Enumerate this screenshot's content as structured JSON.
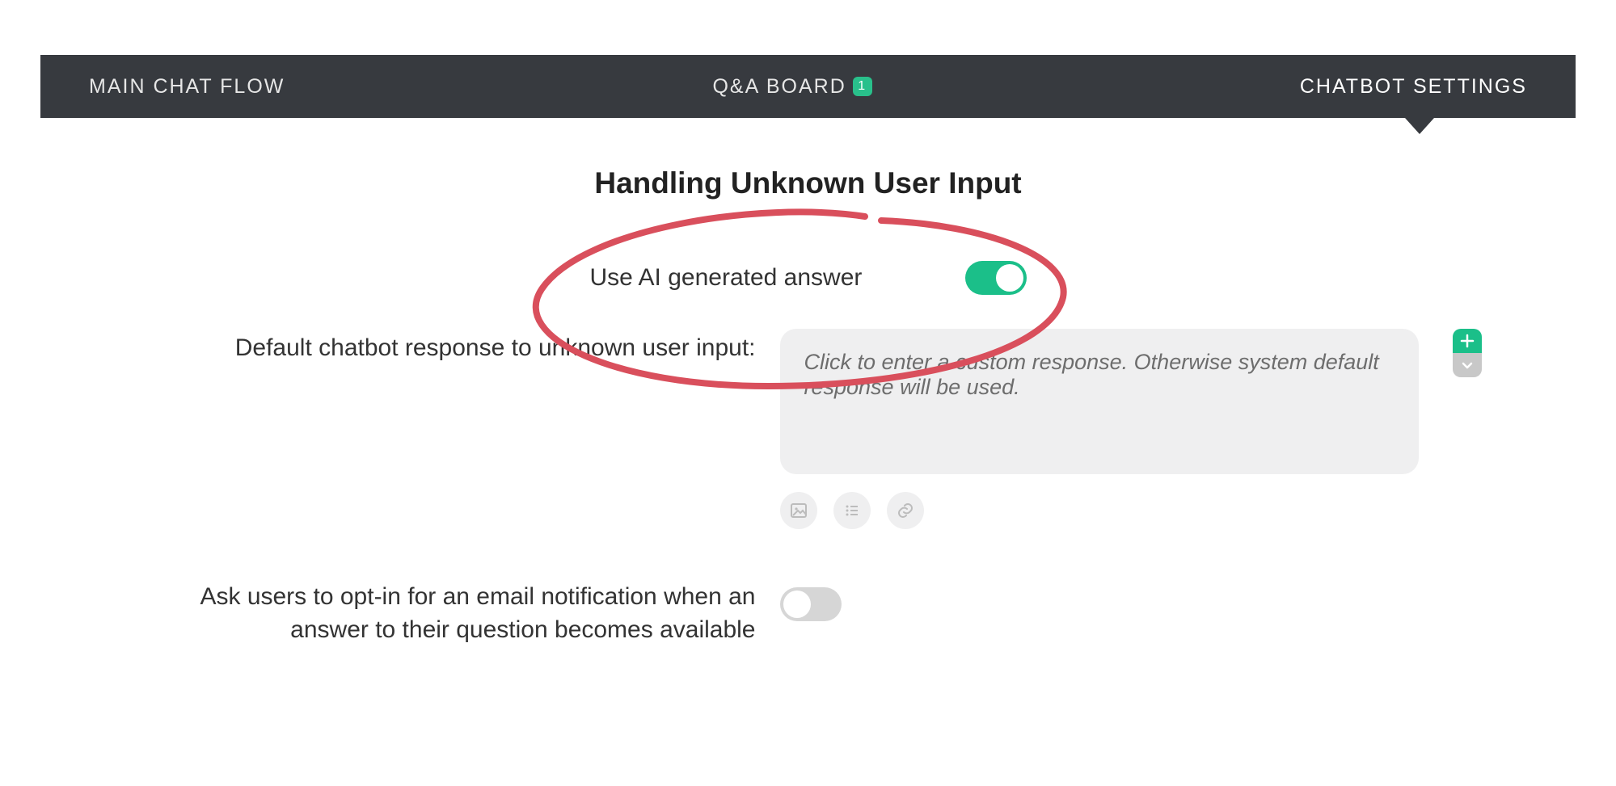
{
  "nav": {
    "items": [
      {
        "label": "MAIN CHAT FLOW"
      },
      {
        "label": "Q&A BOARD",
        "badge": "1"
      },
      {
        "label": "CHATBOT SETTINGS"
      }
    ],
    "active_index": 2
  },
  "section": {
    "title": "Handling Unknown User Input"
  },
  "settings": {
    "ai_toggle": {
      "label": "Use AI generated answer",
      "on": true
    },
    "default_response": {
      "label": "Default chatbot response to unknown user input:",
      "placeholder": "Click to enter a custom response. Otherwise system default response will be used."
    },
    "opt_in_email": {
      "label": "Ask users to opt-in for an email notification when an answer to their question becomes available",
      "on": false
    }
  },
  "colors": {
    "navbar_bg": "#373a3f",
    "accent": "#1bbf89",
    "annotation": "#d94f5c"
  },
  "icons": {
    "add": "plus-icon",
    "expand": "chevron-down-icon",
    "image": "image-icon",
    "list": "list-icon",
    "link": "link-icon"
  }
}
